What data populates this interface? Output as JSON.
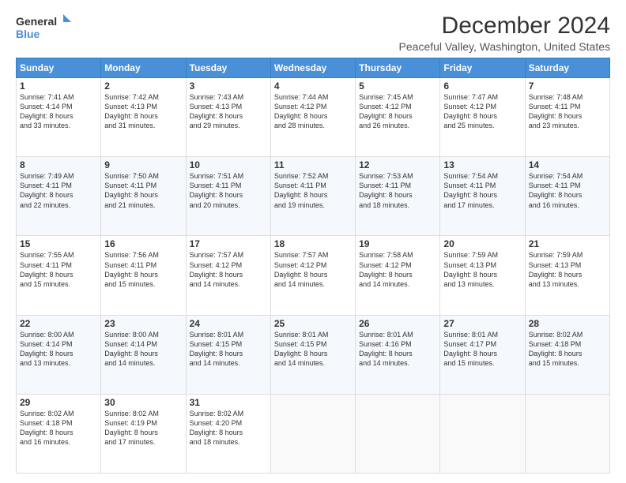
{
  "header": {
    "logo_line1": "General",
    "logo_line2": "Blue",
    "title": "December 2024",
    "subtitle": "Peaceful Valley, Washington, United States"
  },
  "days_of_week": [
    "Sunday",
    "Monday",
    "Tuesday",
    "Wednesday",
    "Thursday",
    "Friday",
    "Saturday"
  ],
  "weeks": [
    [
      {
        "day": 1,
        "sunrise": "7:41 AM",
        "sunset": "4:14 PM",
        "daylight": "8 hours and 33 minutes."
      },
      {
        "day": 2,
        "sunrise": "7:42 AM",
        "sunset": "4:13 PM",
        "daylight": "8 hours and 31 minutes."
      },
      {
        "day": 3,
        "sunrise": "7:43 AM",
        "sunset": "4:13 PM",
        "daylight": "8 hours and 29 minutes."
      },
      {
        "day": 4,
        "sunrise": "7:44 AM",
        "sunset": "4:12 PM",
        "daylight": "8 hours and 28 minutes."
      },
      {
        "day": 5,
        "sunrise": "7:45 AM",
        "sunset": "4:12 PM",
        "daylight": "8 hours and 26 minutes."
      },
      {
        "day": 6,
        "sunrise": "7:47 AM",
        "sunset": "4:12 PM",
        "daylight": "8 hours and 25 minutes."
      },
      {
        "day": 7,
        "sunrise": "7:48 AM",
        "sunset": "4:11 PM",
        "daylight": "8 hours and 23 minutes."
      }
    ],
    [
      {
        "day": 8,
        "sunrise": "7:49 AM",
        "sunset": "4:11 PM",
        "daylight": "8 hours and 22 minutes."
      },
      {
        "day": 9,
        "sunrise": "7:50 AM",
        "sunset": "4:11 PM",
        "daylight": "8 hours and 21 minutes."
      },
      {
        "day": 10,
        "sunrise": "7:51 AM",
        "sunset": "4:11 PM",
        "daylight": "8 hours and 20 minutes."
      },
      {
        "day": 11,
        "sunrise": "7:52 AM",
        "sunset": "4:11 PM",
        "daylight": "8 hours and 19 minutes."
      },
      {
        "day": 12,
        "sunrise": "7:53 AM",
        "sunset": "4:11 PM",
        "daylight": "8 hours and 18 minutes."
      },
      {
        "day": 13,
        "sunrise": "7:54 AM",
        "sunset": "4:11 PM",
        "daylight": "8 hours and 17 minutes."
      },
      {
        "day": 14,
        "sunrise": "7:54 AM",
        "sunset": "4:11 PM",
        "daylight": "8 hours and 16 minutes."
      }
    ],
    [
      {
        "day": 15,
        "sunrise": "7:55 AM",
        "sunset": "4:11 PM",
        "daylight": "8 hours and 15 minutes."
      },
      {
        "day": 16,
        "sunrise": "7:56 AM",
        "sunset": "4:11 PM",
        "daylight": "8 hours and 15 minutes."
      },
      {
        "day": 17,
        "sunrise": "7:57 AM",
        "sunset": "4:12 PM",
        "daylight": "8 hours and 14 minutes."
      },
      {
        "day": 18,
        "sunrise": "7:57 AM",
        "sunset": "4:12 PM",
        "daylight": "8 hours and 14 minutes."
      },
      {
        "day": 19,
        "sunrise": "7:58 AM",
        "sunset": "4:12 PM",
        "daylight": "8 hours and 14 minutes."
      },
      {
        "day": 20,
        "sunrise": "7:59 AM",
        "sunset": "4:13 PM",
        "daylight": "8 hours and 13 minutes."
      },
      {
        "day": 21,
        "sunrise": "7:59 AM",
        "sunset": "4:13 PM",
        "daylight": "8 hours and 13 minutes."
      }
    ],
    [
      {
        "day": 22,
        "sunrise": "8:00 AM",
        "sunset": "4:14 PM",
        "daylight": "8 hours and 13 minutes."
      },
      {
        "day": 23,
        "sunrise": "8:00 AM",
        "sunset": "4:14 PM",
        "daylight": "8 hours and 14 minutes."
      },
      {
        "day": 24,
        "sunrise": "8:01 AM",
        "sunset": "4:15 PM",
        "daylight": "8 hours and 14 minutes."
      },
      {
        "day": 25,
        "sunrise": "8:01 AM",
        "sunset": "4:15 PM",
        "daylight": "8 hours and 14 minutes."
      },
      {
        "day": 26,
        "sunrise": "8:01 AM",
        "sunset": "4:16 PM",
        "daylight": "8 hours and 14 minutes."
      },
      {
        "day": 27,
        "sunrise": "8:01 AM",
        "sunset": "4:17 PM",
        "daylight": "8 hours and 15 minutes."
      },
      {
        "day": 28,
        "sunrise": "8:02 AM",
        "sunset": "4:18 PM",
        "daylight": "8 hours and 15 minutes."
      }
    ],
    [
      {
        "day": 29,
        "sunrise": "8:02 AM",
        "sunset": "4:18 PM",
        "daylight": "8 hours and 16 minutes."
      },
      {
        "day": 30,
        "sunrise": "8:02 AM",
        "sunset": "4:19 PM",
        "daylight": "8 hours and 17 minutes."
      },
      {
        "day": 31,
        "sunrise": "8:02 AM",
        "sunset": "4:20 PM",
        "daylight": "8 hours and 18 minutes."
      },
      null,
      null,
      null,
      null
    ]
  ],
  "labels": {
    "sunrise": "Sunrise:",
    "sunset": "Sunset:",
    "daylight": "Daylight:"
  }
}
